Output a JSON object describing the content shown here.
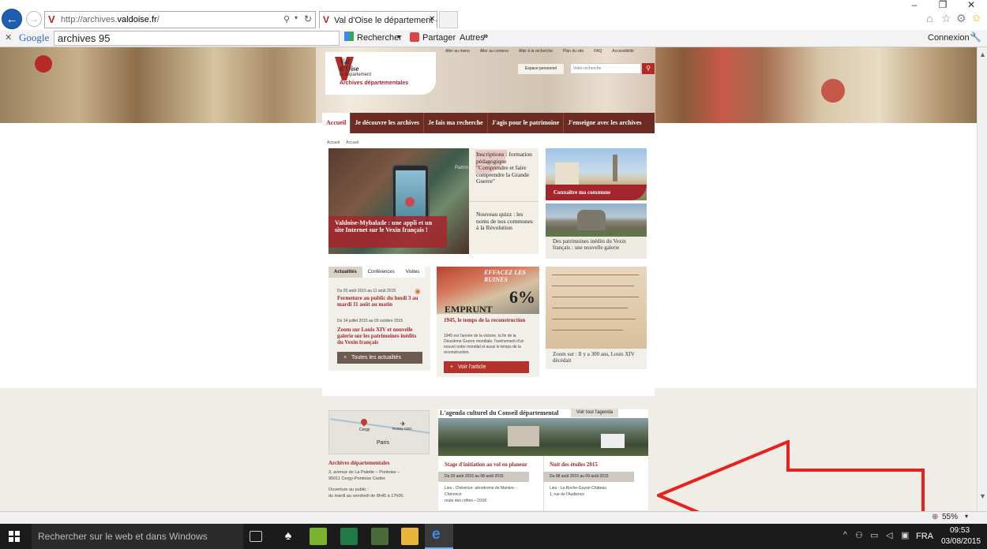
{
  "browser": {
    "address_prefix": "http://archives.",
    "address_domain": "valdoise.fr",
    "address_suffix": "/",
    "tab_title": "Val d'Oise le département – ...",
    "window_controls": [
      "–",
      "❐",
      "✕"
    ]
  },
  "toolbar": {
    "google_label": "Google",
    "search_value": "archives 95",
    "rechercher": "Rechercher",
    "partager": "Partager",
    "autres": "Autres",
    "connexion": "Connexion"
  },
  "site": {
    "top_links": [
      "Aller au menu",
      "Aller au contenu",
      "Aller à la recherche",
      "Plan du site",
      "FAQ",
      "Accessibilité"
    ],
    "logo_val": "Val",
    "logo_doise": "d'Oise",
    "logo_dept": "le département",
    "logo_sub": "Archives départementales",
    "espace_personnel": "Espace personnel",
    "search_placeholder": "Votre recherche",
    "nav": [
      "Accueil",
      "Je découvre les archives",
      "Je fais ma recherche",
      "J'agis pour le patrimoine",
      "J'enseigne avec les archives"
    ],
    "breadcrumb": [
      "Accueil",
      "Accueil"
    ]
  },
  "hero": {
    "caption": "Valdoise-Mybalade : une appli et un site Internet sur le Vexin français !",
    "patrim_text": "Patrim",
    "item1": "Inscriptions : formation pédagogique \"Comprendre et faire comprendre la Grande Guerre\"",
    "item2": "Nouveau quizz : les noms de nos communes à la Révolution",
    "right1": "Connaître ma commune",
    "right2": "Des patrimoines inédits du Vexin français : une nouvelle galerie"
  },
  "news": {
    "tabs": [
      "Actualités",
      "Conférences",
      "Visites"
    ],
    "d1": "Du 03 août 2015 au 11 août 2015",
    "t1": "Fermeture au public du lundi 3 au mardi 11 août au matin",
    "d2": "Du 14 juillet 2015 au 03 octobre 2015",
    "t2": "Zoom sur Louis XIV et nouvelle galerie sur les patrimoines inédits du Vexin français",
    "all": "Toutes les actualités"
  },
  "poster": {
    "top": "EFFACEZ LES RUINES",
    "bottom": "EMPRUNT",
    "pct": "6%"
  },
  "article": {
    "title": "1945, le temps de la reconstruction",
    "text": "1945 est l'année de la victoire, la fin de la Deuxième Guerre mondiale, l'avènement d'un nouvel ordre mondial et aussi le temps de la reconstruction.",
    "button": "Voir l'article"
  },
  "zoom": {
    "title": "Zoom sur : Il y a 300 ans, Louis XIV décédait"
  },
  "map": {
    "cergy": "Cergy",
    "roissy": "Roissy CDG",
    "paris": "Paris"
  },
  "address": {
    "title": "Archives départementales",
    "line1": "3, avenue de La Palette – Pontoise –",
    "line2": "95011 Cergy-Pontoise Cedex",
    "line3": "Ouverture au public :",
    "line4": "du mardi au vendredi de 8h45 à 17h00."
  },
  "agenda": {
    "title": "L'agenda culturel du Conseil départemental",
    "link": "Voir tout l'agenda",
    "e1_title": "Stage d'initiation au vol en planeur",
    "e1_date": "Du 03 août 2015 au 08 août 2015",
    "e1_loc1": "Lieu : Chérence- aérodrome de Mantes-",
    "e1_loc2": "Chérence",
    "e1_loc3": "route des crêtes – D100",
    "e2_title": "Nuit des étoiles 2015",
    "e2_date": "Du 08 août 2015 au 09 août 2015",
    "e2_loc1": "Lieu : La Roche-Guyon-Château",
    "e2_loc2": "1, rue de l'Audience"
  },
  "status": {
    "zoom": "55%"
  },
  "taskbar": {
    "search": "Rechercher sur le web et dans Windows",
    "lang": "FRA",
    "time": "09:53",
    "date": "03/08/2015"
  },
  "colors": {
    "brand_red": "#a4262c",
    "nav_brown": "#6b2a22",
    "annotation_arrow": "#e8211d"
  }
}
